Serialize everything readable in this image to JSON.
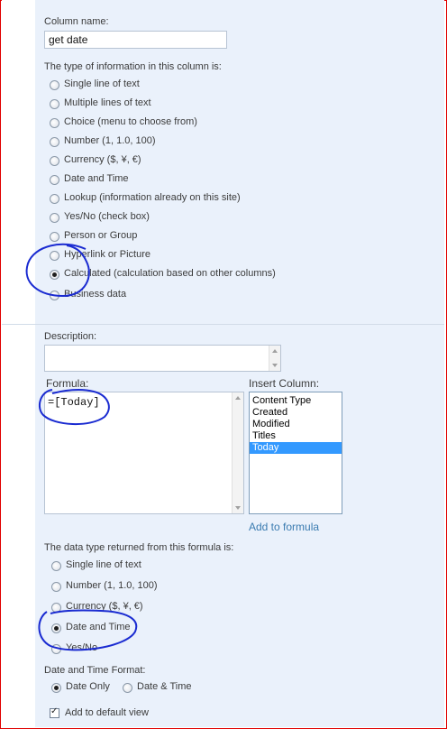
{
  "column_name": {
    "label": "Column name:",
    "value": "get date"
  },
  "type_section": {
    "label": "The type of information in this column is:",
    "options": [
      {
        "label": "Single line of text",
        "checked": false
      },
      {
        "label": "Multiple lines of text",
        "checked": false
      },
      {
        "label": "Choice (menu to choose from)",
        "checked": false
      },
      {
        "label": "Number (1, 1.0, 100)",
        "checked": false
      },
      {
        "label": "Currency ($, ¥, €)",
        "checked": false
      },
      {
        "label": "Date and Time",
        "checked": false
      },
      {
        "label": "Lookup (information already on this site)",
        "checked": false
      },
      {
        "label": "Yes/No (check box)",
        "checked": false
      },
      {
        "label": "Person or Group",
        "checked": false
      },
      {
        "label": "Hyperlink or Picture",
        "checked": false
      },
      {
        "label": "Calculated (calculation based on other columns)",
        "checked": true
      },
      {
        "label": "Business data",
        "checked": false
      }
    ]
  },
  "description": {
    "label": "Description:",
    "value": ""
  },
  "formula": {
    "label": "Formula:",
    "value": "=[Today]"
  },
  "insert_column": {
    "label": "Insert Column:",
    "items": [
      "Content Type",
      "Created",
      "Modified",
      "Titles",
      "Today"
    ],
    "selected": "Today",
    "add_link": "Add to formula"
  },
  "return_type": {
    "label": "The data type returned from this formula is:",
    "options": [
      {
        "label": "Single line of text",
        "checked": false
      },
      {
        "label": "Number (1, 1.0, 100)",
        "checked": false
      },
      {
        "label": "Currency ($, ¥, €)",
        "checked": false
      },
      {
        "label": "Date and Time",
        "checked": true
      },
      {
        "label": "Yes/No",
        "checked": false
      }
    ]
  },
  "date_format": {
    "label": "Date and Time Format:",
    "options": [
      {
        "label": "Date Only",
        "checked": true
      },
      {
        "label": "Date & Time",
        "checked": false
      }
    ]
  },
  "add_to_default_view": {
    "label": "Add to default view",
    "checked": true
  },
  "colors": {
    "frame_border": "#e00000",
    "panel_bg": "#eaf1fb",
    "annotation_ink": "#1a2bd1",
    "selection": "#3399ff",
    "link": "#3a7bb0"
  }
}
